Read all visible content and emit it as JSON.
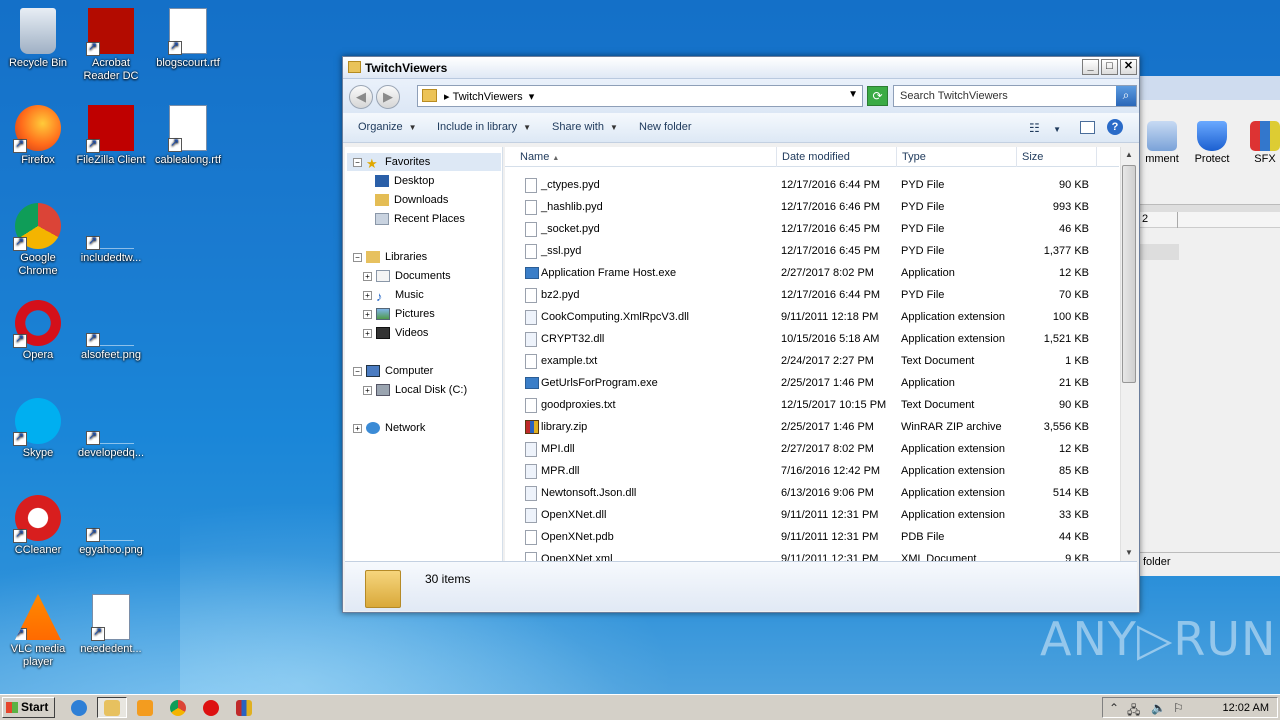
{
  "desktop": {
    "icons": [
      {
        "label": "Recycle Bin",
        "icon": "recycle-bin-icon"
      },
      {
        "label": "Acrobat Reader DC",
        "icon": "acrobat-icon"
      },
      {
        "label": "blogscourt.rtf",
        "icon": "word-doc-icon"
      },
      {
        "label": "Firefox",
        "icon": "firefox-icon"
      },
      {
        "label": "FileZilla Client",
        "icon": "filezilla-icon"
      },
      {
        "label": "cablealong.rtf",
        "icon": "word-doc-icon"
      },
      {
        "label": "Google Chrome",
        "icon": "chrome-icon"
      },
      {
        "label": "includedtw...",
        "icon": "blank-file-icon"
      },
      {
        "label": "Opera",
        "icon": "opera-icon"
      },
      {
        "label": "alsofeet.png",
        "icon": "blank-file-icon"
      },
      {
        "label": "Skype",
        "icon": "skype-icon"
      },
      {
        "label": "developedq...",
        "icon": "blank-file-icon"
      },
      {
        "label": "CCleaner",
        "icon": "ccleaner-icon"
      },
      {
        "label": "egyahoo.png",
        "icon": "blank-file-icon"
      },
      {
        "label": "VLC media player",
        "icon": "vlc-icon"
      },
      {
        "label": "neededent...",
        "icon": "word-doc-icon"
      }
    ]
  },
  "background_window": {
    "tools": [
      {
        "label": "mment"
      },
      {
        "label": "Protect"
      },
      {
        "label": "SFX"
      }
    ],
    "cell_text": "2",
    "status_text": "folder"
  },
  "explorer": {
    "title": "TwitchViewers",
    "breadcrumb": "TwitchViewers",
    "search_placeholder": "Search TwitchViewers",
    "commands": {
      "organize": "Organize",
      "include_in_library": "Include in library",
      "share_with": "Share with",
      "new_folder": "New folder"
    },
    "nav": {
      "favorites": "Favorites",
      "desktop": "Desktop",
      "downloads": "Downloads",
      "recent_places": "Recent Places",
      "libraries": "Libraries",
      "documents": "Documents",
      "music": "Music",
      "pictures": "Pictures",
      "videos": "Videos",
      "computer": "Computer",
      "local_disk": "Local Disk (C:)",
      "network": "Network"
    },
    "columns": {
      "name": "Name",
      "date_modified": "Date modified",
      "type": "Type",
      "size": "Size"
    },
    "files": [
      {
        "name": "_ctypes.pyd",
        "date": "12/17/2016 6:44 PM",
        "type": "PYD File",
        "size": "90 KB",
        "kind": "file"
      },
      {
        "name": "_hashlib.pyd",
        "date": "12/17/2016 6:46 PM",
        "type": "PYD File",
        "size": "993 KB",
        "kind": "file"
      },
      {
        "name": "_socket.pyd",
        "date": "12/17/2016 6:45 PM",
        "type": "PYD File",
        "size": "46 KB",
        "kind": "file"
      },
      {
        "name": "_ssl.pyd",
        "date": "12/17/2016 6:45 PM",
        "type": "PYD File",
        "size": "1,377 KB",
        "kind": "file"
      },
      {
        "name": "Application Frame Host.exe",
        "date": "2/27/2017 8:02 PM",
        "type": "Application",
        "size": "12 KB",
        "kind": "app"
      },
      {
        "name": "bz2.pyd",
        "date": "12/17/2016 6:44 PM",
        "type": "PYD File",
        "size": "70 KB",
        "kind": "file"
      },
      {
        "name": "CookComputing.XmlRpcV3.dll",
        "date": "9/11/2011 12:18 PM",
        "type": "Application extension",
        "size": "100 KB",
        "kind": "dll"
      },
      {
        "name": "CRYPT32.dll",
        "date": "10/15/2016 5:18 AM",
        "type": "Application extension",
        "size": "1,521 KB",
        "kind": "dll"
      },
      {
        "name": "example.txt",
        "date": "2/24/2017 2:27 PM",
        "type": "Text Document",
        "size": "1 KB",
        "kind": "file"
      },
      {
        "name": "GetUrlsForProgram.exe",
        "date": "2/25/2017 1:46 PM",
        "type": "Application",
        "size": "21 KB",
        "kind": "app"
      },
      {
        "name": "goodproxies.txt",
        "date": "12/15/2017 10:15 PM",
        "type": "Text Document",
        "size": "90 KB",
        "kind": "file"
      },
      {
        "name": "library.zip",
        "date": "2/25/2017 1:46 PM",
        "type": "WinRAR ZIP archive",
        "size": "3,556 KB",
        "kind": "zip"
      },
      {
        "name": "MPI.dll",
        "date": "2/27/2017 8:02 PM",
        "type": "Application extension",
        "size": "12 KB",
        "kind": "dll"
      },
      {
        "name": "MPR.dll",
        "date": "7/16/2016 12:42 PM",
        "type": "Application extension",
        "size": "85 KB",
        "kind": "dll"
      },
      {
        "name": "Newtonsoft.Json.dll",
        "date": "6/13/2016 9:06 PM",
        "type": "Application extension",
        "size": "514 KB",
        "kind": "dll"
      },
      {
        "name": "OpenXNet.dll",
        "date": "9/11/2011 12:31 PM",
        "type": "Application extension",
        "size": "33 KB",
        "kind": "dll"
      },
      {
        "name": "OpenXNet.pdb",
        "date": "9/11/2011 12:31 PM",
        "type": "PDB File",
        "size": "44 KB",
        "kind": "file"
      },
      {
        "name": "OpenXNet.xml",
        "date": "9/11/2011 12:31 PM",
        "type": "XML Document",
        "size": "9 KB",
        "kind": "file"
      }
    ],
    "item_count": "30 items"
  },
  "taskbar": {
    "start_label": "Start",
    "clock": "12:02 AM"
  },
  "watermark": "ANY▷RUN"
}
